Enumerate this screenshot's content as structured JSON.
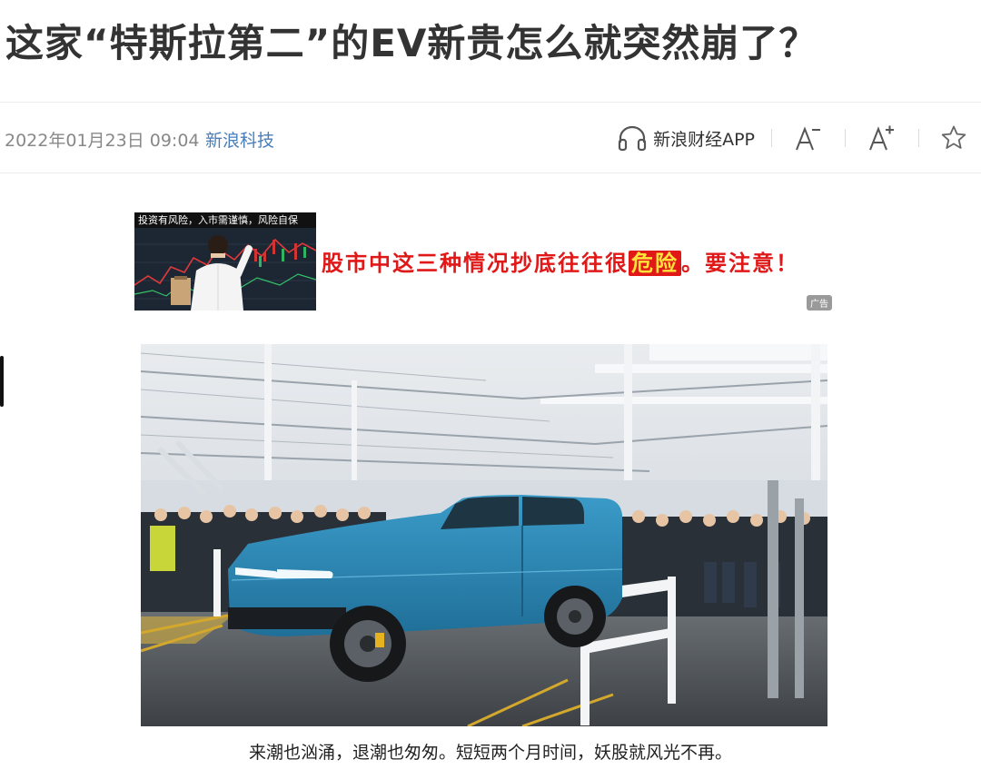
{
  "article": {
    "title": "这家“特斯拉第二”的EV新贵怎么就突然崩了？",
    "datetime": "2022年01月23日 09:04",
    "source": "新浪科技",
    "caption": "来潮也汹涌，退潮也匆匆。短短两个月时间，妖股就风光不再。"
  },
  "toolbar": {
    "app_label": "新浪财经APP",
    "icons": [
      "headphones-icon",
      "font-decrease-icon",
      "font-increase-icon",
      "star-icon"
    ]
  },
  "ad": {
    "warning": "投资有风险，入市需谨慎，风险自保",
    "text_before": "股市中这三种情况抄底往往很",
    "text_highlight": "危险",
    "text_after": "。要注意！",
    "badge": "广告"
  },
  "colors": {
    "title": "#333333",
    "source_link": "#4a7ebb",
    "ad_red": "#e01818",
    "truck_blue": "#2a86b5"
  }
}
